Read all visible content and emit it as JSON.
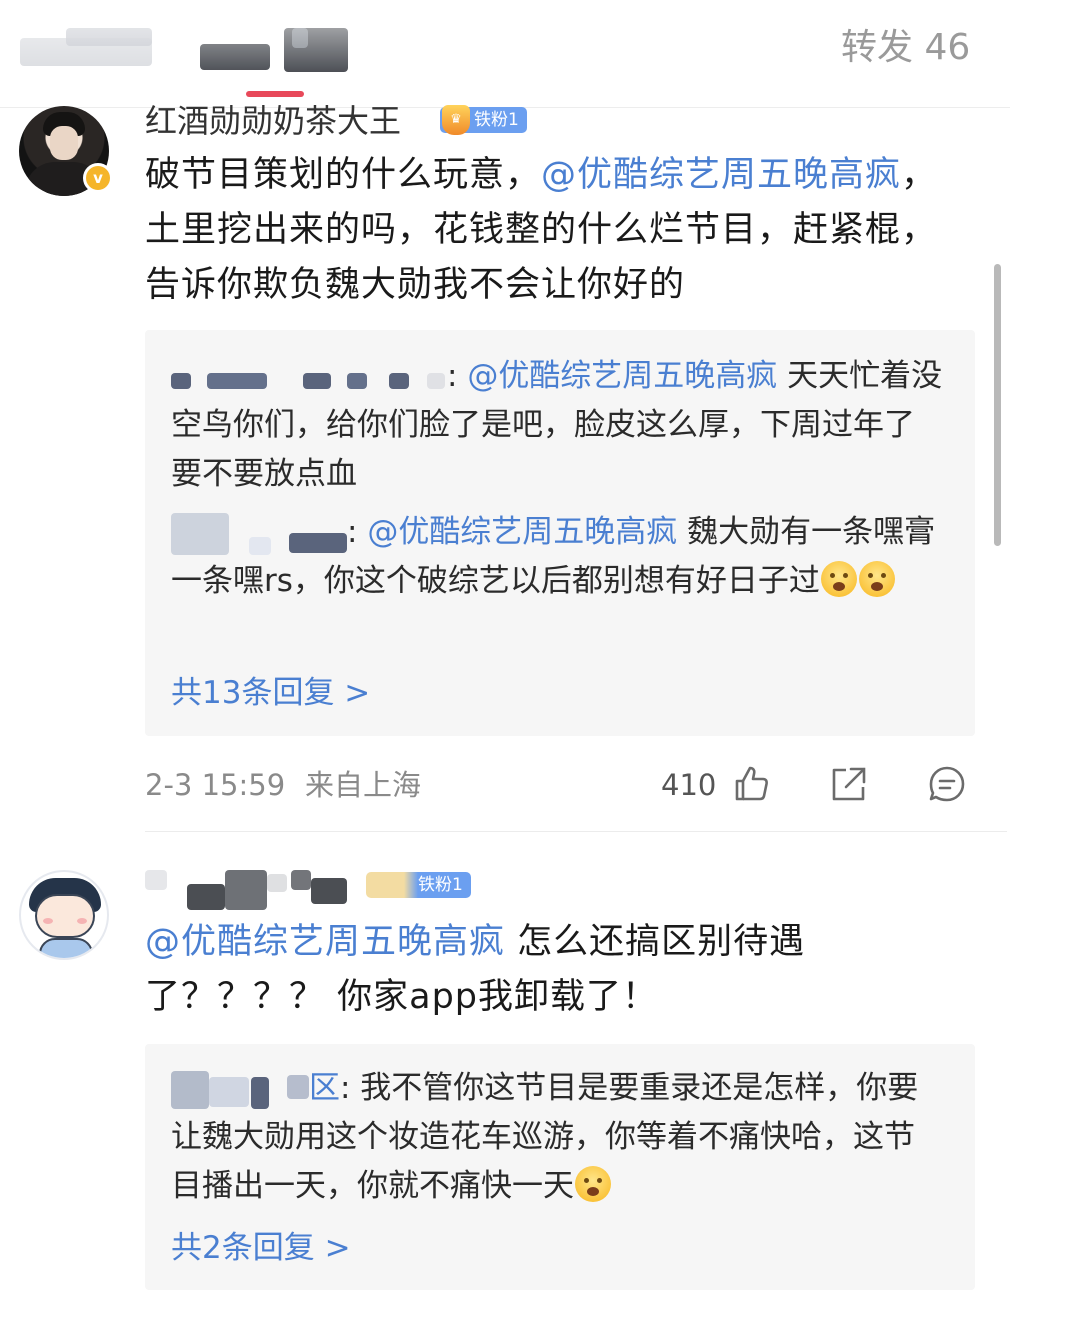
{
  "tabs": {
    "reposts_label": "转发 46",
    "active_indicator_color": "#e8495a"
  },
  "comments": [
    {
      "username": "红酒勋勋奶茶大王",
      "fan_badge": "铁粉1",
      "verified_icon": "v-badge-icon",
      "text_before": "破节目策划的什么玩意，",
      "mention": "@优酷综艺周五晚高疯",
      "text_after": "，土里挖出来的吗，花钱整的什么烂节目，赶紧棍，告诉你欺负魏大勋我不会让你好的",
      "replies": [
        {
          "mention": "@优酷综艺周五晚高疯",
          "text": " 天天忙着没空鸟你们，给你们脸了是吧，脸皮这么厚，下周过年了 要不要放点血"
        },
        {
          "mention": "@优酷综艺周五晚高疯",
          "text": " 魏大勋有一条嘿膏一条嘿rs，你这个破综艺以后都别想有好日子过"
        }
      ],
      "more_replies": "共13条回复 >",
      "time": "2-3 15:59",
      "location": "来自上海",
      "like_count": "410"
    },
    {
      "fan_badge": "铁粉1",
      "mention": "@优酷综艺周五晚高疯",
      "text_after": " 怎么还搞区别待遇了？？？？ 你家app我卸载了！",
      "replies": [
        {
          "name_tail": "区",
          "text": ": 我不管你这节目是要重录还是怎样，你要让魏大勋用这个妆造花车巡游，你等着不痛快哈，这节目播出一天，你就不痛快一天"
        }
      ],
      "more_replies": "共2条回复 >"
    }
  ],
  "colors": {
    "link": "#4a7fd1",
    "meta_text": "#8a8a8a",
    "reply_bg": "#f6f6f6"
  }
}
